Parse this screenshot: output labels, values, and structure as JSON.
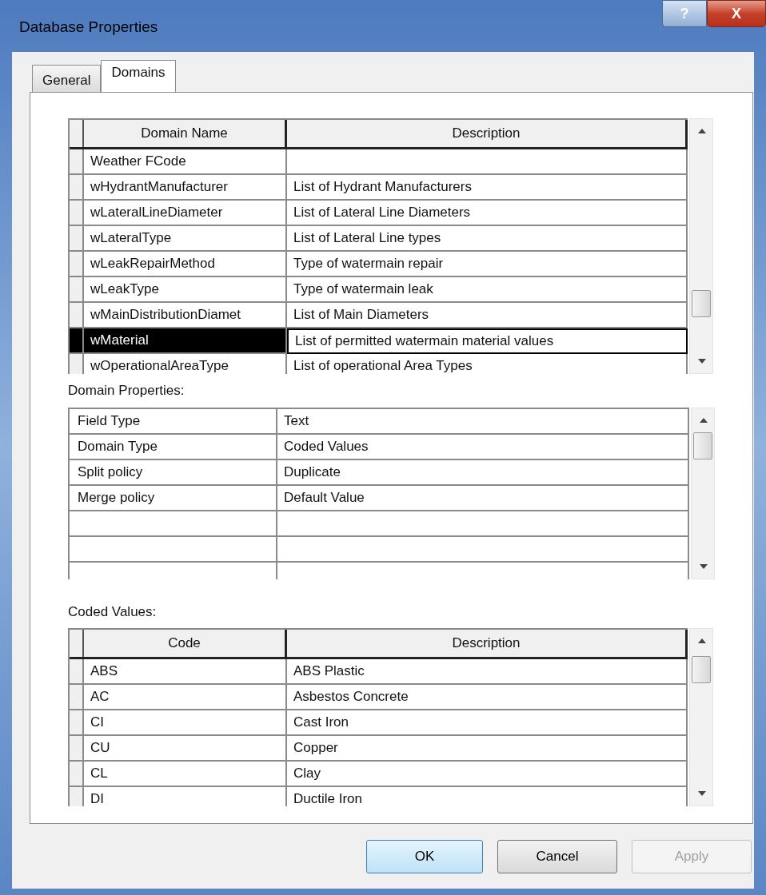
{
  "window": {
    "title": "Database Properties",
    "title_buttons": [
      {
        "kind": "help",
        "label": "?"
      },
      {
        "kind": "close",
        "label": "X"
      }
    ]
  },
  "tabs": [
    {
      "label": "General",
      "selected": false
    },
    {
      "label": "Domains",
      "selected": true
    }
  ],
  "domains": {
    "columns": [
      "Domain Name",
      "Description"
    ],
    "rows": [
      {
        "name": "Weather FCode",
        "description": "",
        "selected": false
      },
      {
        "name": "wHydrantManufacturer",
        "description": "List of Hydrant Manufacturers",
        "selected": false
      },
      {
        "name": "wLateralLineDiameter",
        "description": "List of Lateral Line Diameters",
        "selected": false
      },
      {
        "name": "wLateralType",
        "description": "List of Lateral Line types",
        "selected": false
      },
      {
        "name": "wLeakRepairMethod",
        "description": "Type of watermain repair",
        "selected": false
      },
      {
        "name": "wLeakType",
        "description": "Type of watermain leak",
        "selected": false
      },
      {
        "name": "wMainDistributionDiamet",
        "description": "List of Main Diameters",
        "selected": false
      },
      {
        "name": "wMaterial",
        "description": "List of permitted watermain material values",
        "selected": true
      },
      {
        "name": "wOperationalAreaType",
        "description": "List of operational Area Types",
        "selected": false
      }
    ]
  },
  "domain_properties": {
    "label": "Domain Properties:",
    "rows": [
      {
        "property": "Field Type",
        "value": "Text"
      },
      {
        "property": "Domain Type",
        "value": "Coded Values"
      },
      {
        "property": "Split policy",
        "value": "Duplicate"
      },
      {
        "property": "Merge policy",
        "value": "Default Value"
      }
    ]
  },
  "coded_values": {
    "label": "Coded Values:",
    "columns": [
      "Code",
      "Description"
    ],
    "rows": [
      {
        "code": "ABS",
        "description": "ABS Plastic"
      },
      {
        "code": "AC",
        "description": "Asbestos Concrete"
      },
      {
        "code": "CI",
        "description": "Cast Iron"
      },
      {
        "code": "CU",
        "description": "Copper"
      },
      {
        "code": "CL",
        "description": "Clay"
      },
      {
        "code": "DI",
        "description": "Ductile Iron"
      }
    ]
  },
  "buttons": [
    {
      "label": "OK",
      "default": true,
      "disabled": false
    },
    {
      "label": "Cancel",
      "default": false,
      "disabled": false
    },
    {
      "label": "Apply",
      "default": false,
      "disabled": true
    }
  ]
}
